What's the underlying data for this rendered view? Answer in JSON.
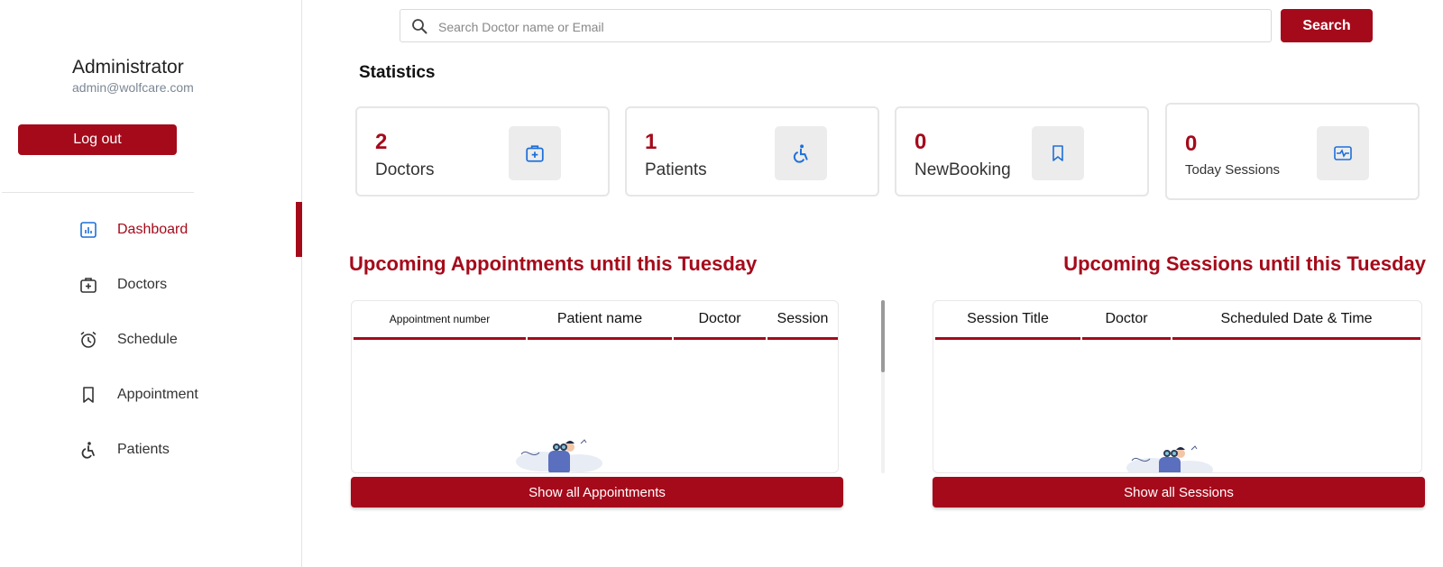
{
  "sidebar": {
    "profile_name": "Administrator",
    "profile_email": "admin@wolfcare.com",
    "logout_label": "Log out",
    "items": [
      {
        "label": "Dashboard",
        "icon": "dashboard-icon",
        "active": true
      },
      {
        "label": "Doctors",
        "icon": "doctor-bag-icon",
        "active": false
      },
      {
        "label": "Schedule",
        "icon": "alarm-clock-icon",
        "active": false
      },
      {
        "label": "Appointment",
        "icon": "bookmark-icon",
        "active": false
      },
      {
        "label": "Patients",
        "icon": "wheelchair-icon",
        "active": false
      }
    ]
  },
  "search": {
    "placeholder": "Search Doctor name or Email",
    "value": "",
    "button_label": "Search"
  },
  "statistics": {
    "title": "Statistics",
    "cards": [
      {
        "value": "2",
        "label": "Doctors",
        "icon": "doctor-bag-icon"
      },
      {
        "value": "1",
        "label": "Patients",
        "icon": "wheelchair-icon"
      },
      {
        "value": "0",
        "label": "NewBooking",
        "icon": "bookmark-icon"
      },
      {
        "value": "0",
        "label": "Today Sessions",
        "icon": "session-icon"
      }
    ]
  },
  "appointments": {
    "title": "Upcoming Appointments until this Tuesday",
    "columns": [
      "Appointment number",
      "Patient name",
      "Doctor",
      "Session"
    ],
    "rows": [],
    "button_label": "Show all Appointments"
  },
  "sessions": {
    "title": "Upcoming Sessions until this Tuesday",
    "columns": [
      "Session Title",
      "Doctor",
      "Scheduled Date & Time"
    ],
    "rows": [],
    "button_label": "Show all Sessions"
  },
  "colors": {
    "accent": "#a50a1b",
    "icon_blue": "#1e6fd9"
  }
}
